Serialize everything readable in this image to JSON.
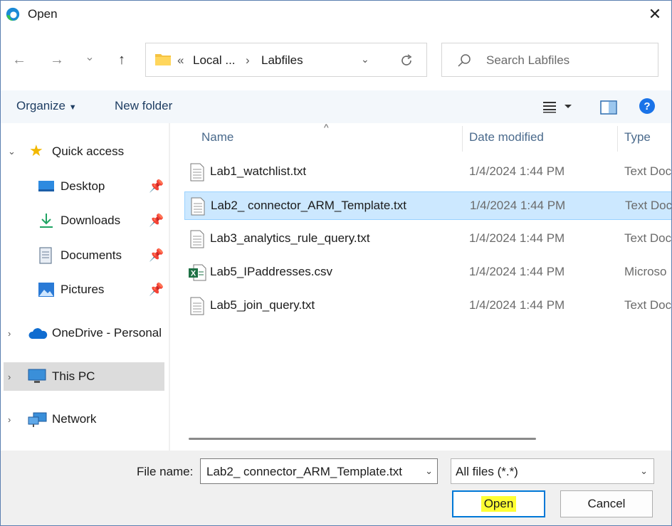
{
  "window": {
    "title": "Open"
  },
  "nav": {
    "back": "←",
    "forward": "→",
    "recent": "⌄",
    "up": "↑"
  },
  "address": {
    "root_chevron": "«",
    "segment1": "Local ...",
    "separator": "›",
    "segment2": "Labfiles"
  },
  "search": {
    "placeholder": "Search Labfiles"
  },
  "toolbar": {
    "organize": "Organize",
    "new_folder": "New folder"
  },
  "sidebar": {
    "quick_access": "Quick access",
    "items": [
      {
        "label": "Desktop",
        "icon": "desktop-icon",
        "pinned": true
      },
      {
        "label": "Downloads",
        "icon": "downloads-icon",
        "pinned": true
      },
      {
        "label": "Documents",
        "icon": "documents-icon",
        "pinned": true
      },
      {
        "label": "Pictures",
        "icon": "pictures-icon",
        "pinned": true
      }
    ],
    "onedrive": "OneDrive - Personal",
    "this_pc": "This PC",
    "network": "Network"
  },
  "columns": {
    "name": "Name",
    "date": "Date modified",
    "type": "Type"
  },
  "files": [
    {
      "name": "Lab1_watchlist.txt",
      "date": "1/4/2024 1:44 PM",
      "type": "Text Doc",
      "icon": "text-file-icon"
    },
    {
      "name": "Lab2_ connector_ARM_Template.txt",
      "date": "1/4/2024 1:44 PM",
      "type": "Text Doc",
      "icon": "text-file-icon",
      "selected": true
    },
    {
      "name": "Lab3_analytics_rule_query.txt",
      "date": "1/4/2024 1:44 PM",
      "type": "Text Doc",
      "icon": "text-file-icon"
    },
    {
      "name": "Lab5_IPaddresses.csv",
      "date": "1/4/2024 1:44 PM",
      "type": "Microso",
      "icon": "excel-file-icon"
    },
    {
      "name": "Lab5_join_query.txt",
      "date": "1/4/2024 1:44 PM",
      "type": "Text Doc",
      "icon": "text-file-icon"
    }
  ],
  "footer": {
    "file_name_label": "File name:",
    "file_name_value": "Lab2_ connector_ARM_Template.txt",
    "filter": "All files (*.*)",
    "open": "Open",
    "cancel": "Cancel"
  },
  "colors": {
    "accent": "#0078d7",
    "selection": "#cce8ff",
    "highlight": "#ffff33"
  }
}
